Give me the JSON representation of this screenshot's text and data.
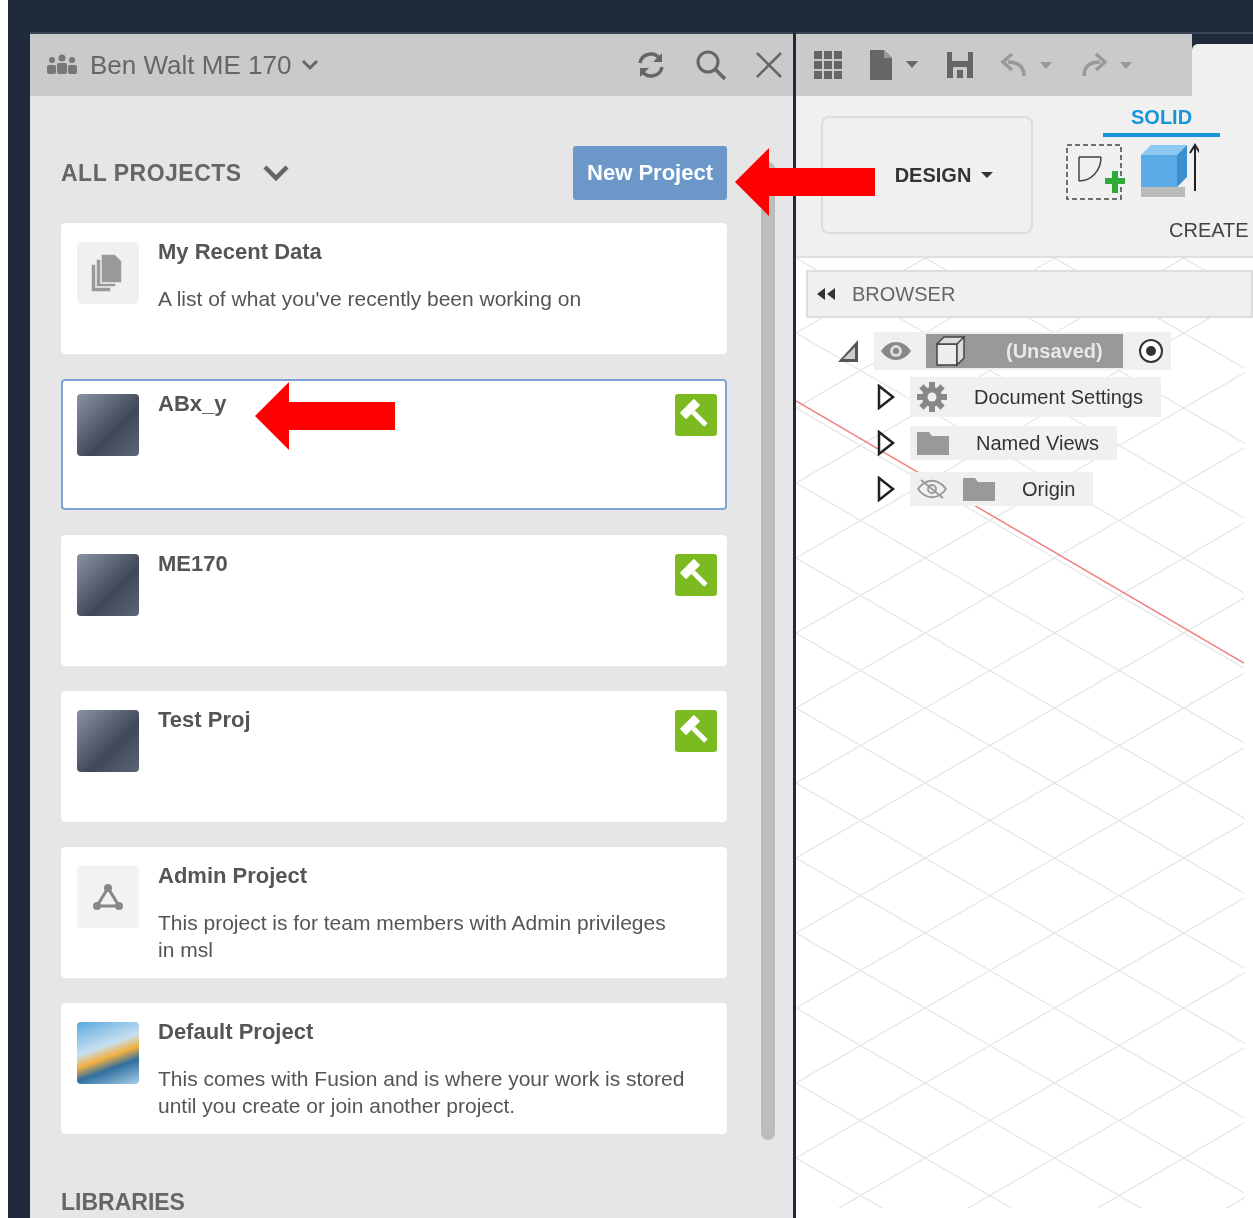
{
  "project_panel": {
    "team_name": "Ben Walt ME 170",
    "section_title": "ALL PROJECTS",
    "new_button": "New Project",
    "projects": [
      {
        "kind": "recent",
        "title": "My Recent Data",
        "description": "A list of what you've recently been working on",
        "selected": false,
        "badge": false
      },
      {
        "kind": "photo",
        "title": "ABx_y",
        "selected": true,
        "badge": true
      },
      {
        "kind": "photo",
        "title": "ME170",
        "selected": false,
        "badge": true
      },
      {
        "kind": "photo",
        "title": "Test Proj",
        "selected": false,
        "badge": true
      },
      {
        "kind": "admin",
        "title": "Admin Project",
        "description": "This project is for team members with Admin privileges in msl",
        "selected": false,
        "badge": false
      },
      {
        "kind": "default",
        "title": "Default Project",
        "description": "This comes with Fusion and is where your work is stored until you create or join another project.",
        "selected": false,
        "badge": false
      }
    ],
    "libraries_title": "LIBRARIES"
  },
  "design": {
    "workspace": "DESIGN",
    "tabs": [
      {
        "label": "SOLID",
        "selected": true
      }
    ],
    "group_label": "CREATE",
    "browser_title": "BROWSER",
    "tree": [
      {
        "label": "(Unsaved)",
        "kind": "component",
        "expanded": true,
        "visible": true,
        "children": [
          {
            "label": "Document Settings",
            "kind": "settings",
            "expanded": false
          },
          {
            "label": "Named Views",
            "kind": "folder",
            "expanded": false
          },
          {
            "label": "Origin",
            "kind": "folder",
            "expanded": false,
            "visible": false
          }
        ]
      }
    ]
  }
}
